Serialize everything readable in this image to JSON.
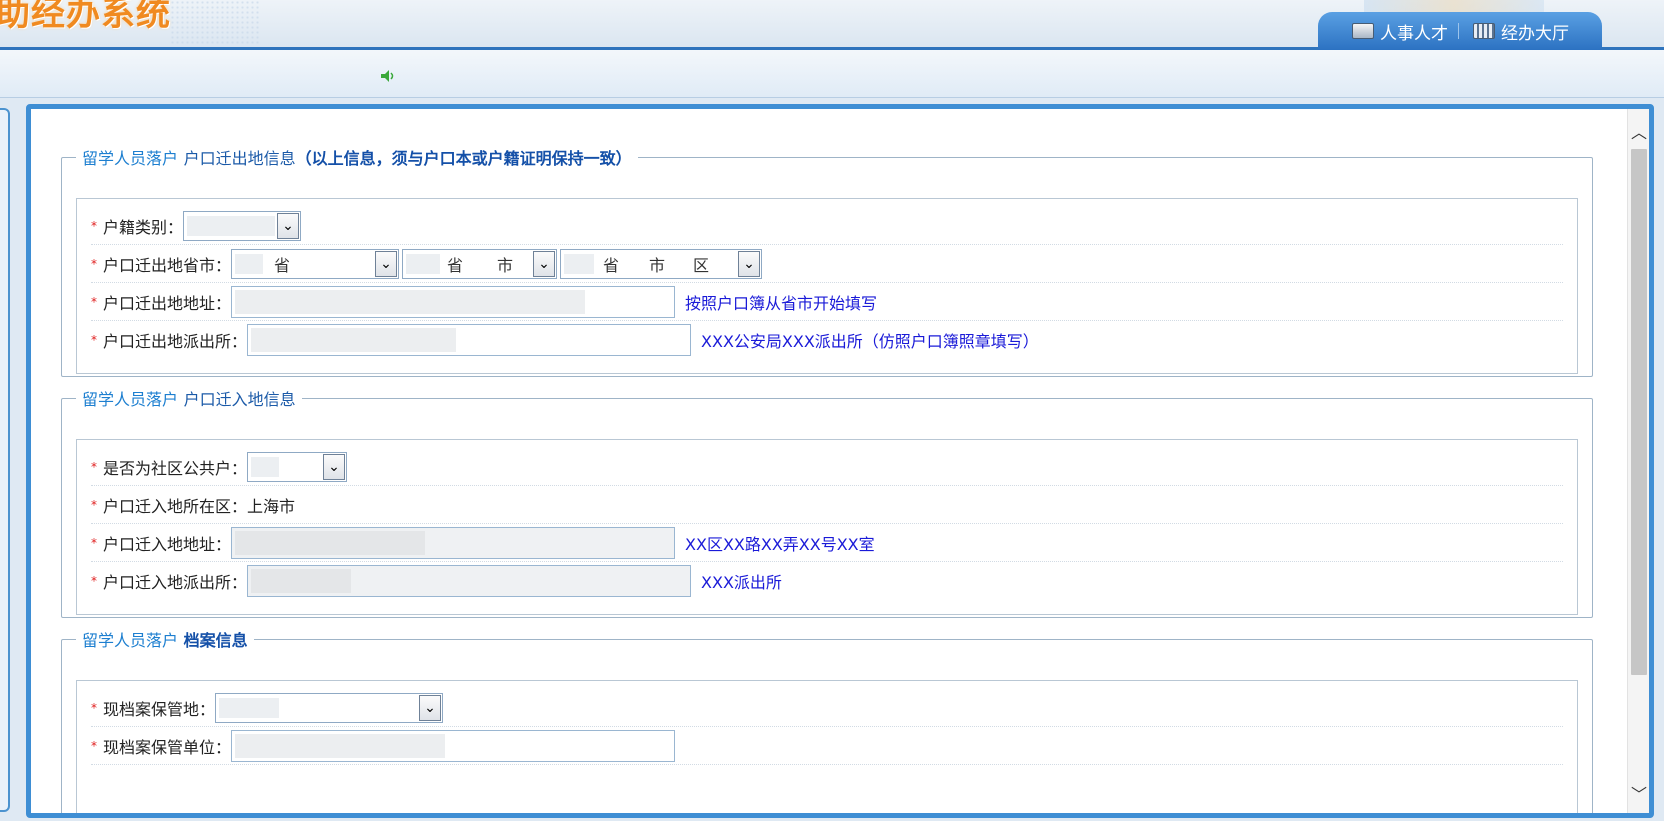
{
  "header": {
    "logo_text": "助经办系统",
    "nav": [
      {
        "label": "人事人才",
        "icon": "laptop-icon"
      },
      {
        "label": "经办大厅",
        "icon": "building-icon"
      }
    ]
  },
  "subbar": {
    "icon": "speaker-icon"
  },
  "sections": {
    "out": {
      "legend_a": "留学人员落户",
      "legend_b": "户口迁出地信息",
      "legend_c": "（以上信息，须与户口本或户籍证明保持一致）",
      "huji_label": "户籍类别：",
      "province_label": "户口迁出地省市：",
      "province_select": "省",
      "city_select_a": "省",
      "city_select_b": "市",
      "district_select_a": "省",
      "district_select_b": "市",
      "district_select_c": "区",
      "address_label": "户口迁出地地址：",
      "address_hint": "按照户口簿从省市开始填写",
      "police_label": "户口迁出地派出所：",
      "police_hint": "XXX公安局XXX派出所（仿照户口簿照章填写）"
    },
    "in": {
      "legend_a": "留学人员落户",
      "legend_b": "户口迁入地信息",
      "community_label": "是否为社区公共户：",
      "district_label": "户口迁入地所在区：",
      "district_value": "上海市",
      "address_label": "户口迁入地地址：",
      "address_hint": "XX区XX路XX弄XX号XX室",
      "police_label": "户口迁入地派出所：",
      "police_hint": "XXX派出所"
    },
    "archive": {
      "legend_a": "留学人员落户",
      "legend_b": "档案信息",
      "location_label": "现档案保管地：",
      "unit_label": "现档案保管单位："
    }
  },
  "colors": {
    "accent": "#3e8ed4",
    "hint": "#1a1ad8",
    "required": "#e02020",
    "logo": "#f08a20"
  }
}
